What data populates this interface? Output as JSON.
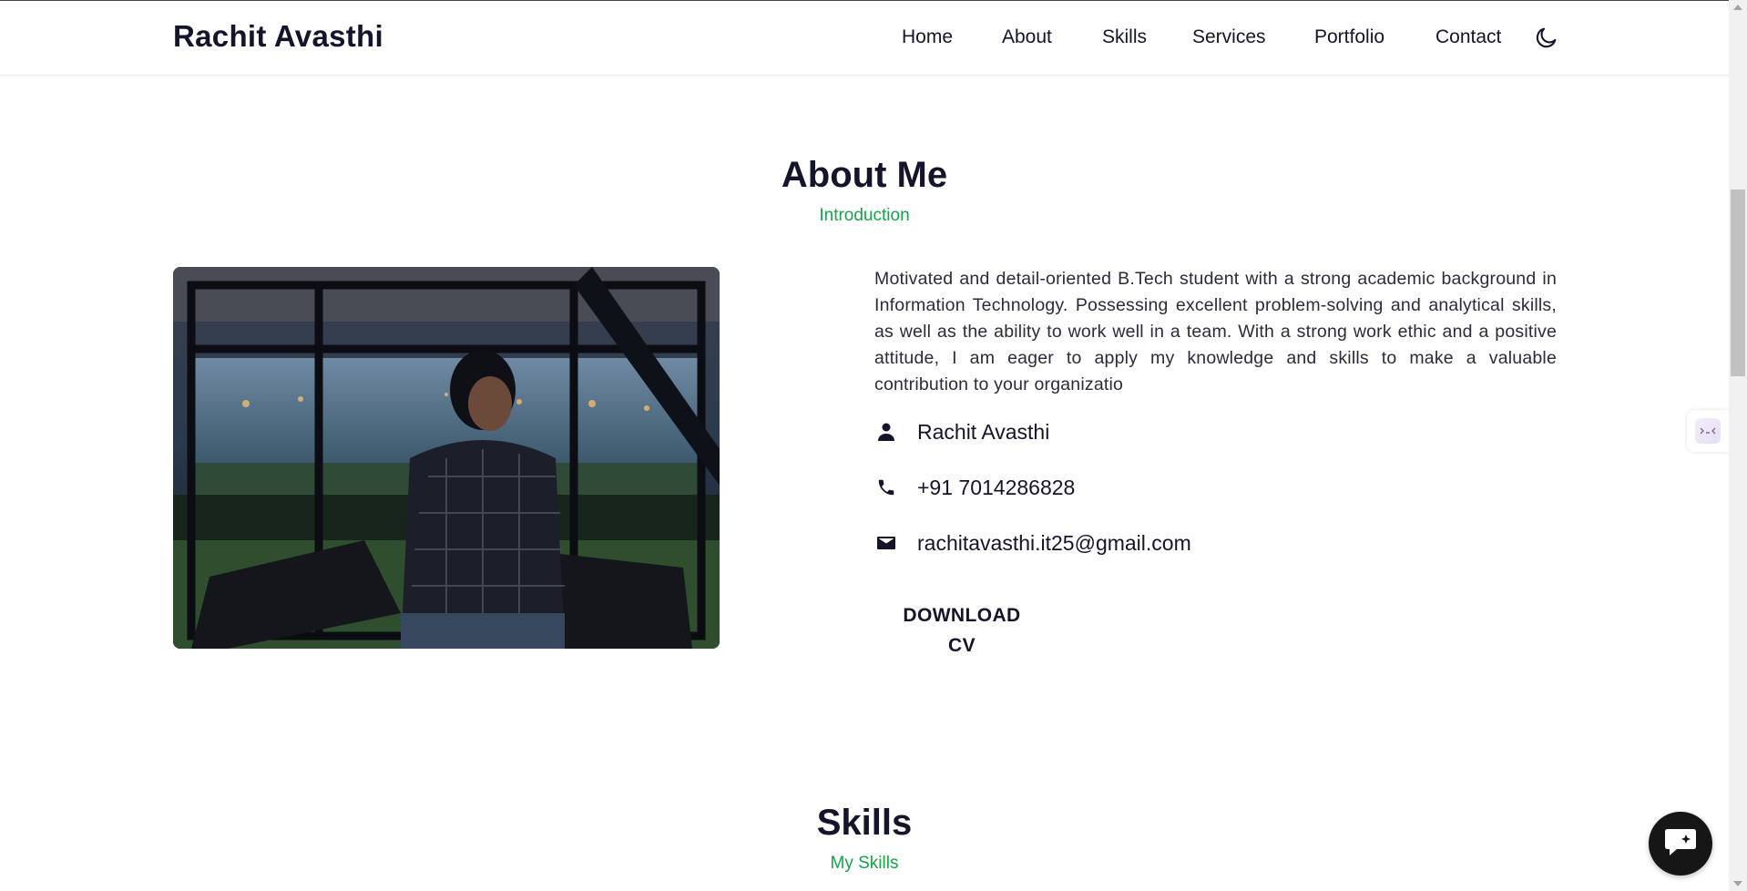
{
  "header": {
    "logo": "Rachit Avasthi",
    "nav": [
      "Home",
      "About",
      "Skills",
      "Services",
      "Portfolio",
      "Contact"
    ],
    "theme_icon": "moon-icon"
  },
  "about": {
    "title": "About Me",
    "subtitle": "Introduction",
    "description": "Motivated and detail-oriented B.Tech student with a strong academic background in Information Technology. Possessing excellent problem-solving and analytical skills, as well as the ability to work well in a team. With a strong work ethic and a positive attitude, I am eager to apply my knowledge and skills to make a valuable contribution to your organizatio",
    "name": "Rachit Avasthi",
    "phone": "+91 7014286828",
    "email": "rachitavasthi.it25@gmail.com",
    "download_line1": "DOWNLOAD",
    "download_line2": "CV"
  },
  "skills": {
    "title": "Skills",
    "subtitle": "My Skills"
  },
  "icons": {
    "name": "person-icon",
    "phone": "phone-icon",
    "email": "mail-icon",
    "chat": "chat-icon",
    "widget": "extension-widget-icon"
  },
  "colors": {
    "accent": "#16a34a",
    "text": "#14142b"
  }
}
